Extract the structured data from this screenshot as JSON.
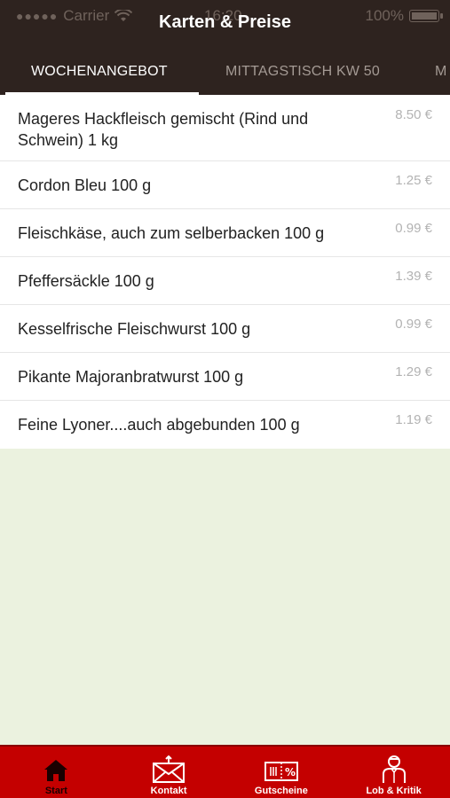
{
  "status": {
    "carrier": "Carrier",
    "time": "16:20",
    "battery": "100%"
  },
  "header": {
    "title": "Karten & Preise"
  },
  "tabs": [
    {
      "label": "WOCHENANGEBOT"
    },
    {
      "label": "MITTAGSTISCH KW 50"
    },
    {
      "label": "M"
    }
  ],
  "items": [
    {
      "name": "Mageres Hackfleisch gemischt (Rind und Schwein) 1 kg",
      "price": "8.50 €"
    },
    {
      "name": "Cordon Bleu 100 g",
      "price": "1.25 €"
    },
    {
      "name": "Fleischkäse, auch zum selberbacken 100 g",
      "price": "0.99 €"
    },
    {
      "name": "Pfeffersäckle 100 g",
      "price": "1.39 €"
    },
    {
      "name": "Kesselfrische Fleischwurst 100 g",
      "price": "0.99 €"
    },
    {
      "name": "Pikante Majoranbratwurst 100 g",
      "price": "1.29 €"
    },
    {
      "name": "Feine Lyoner....auch abgebunden 100 g",
      "price": "1.19 €"
    }
  ],
  "tabbar": [
    {
      "label": "Start",
      "icon": "house-icon"
    },
    {
      "label": "Kontakt",
      "icon": "envelope-icon"
    },
    {
      "label": "Gutscheine",
      "icon": "coupon-icon"
    },
    {
      "label": "Lob & Kritik",
      "icon": "waiter-icon"
    }
  ],
  "colors": {
    "header": "#2e231f",
    "tabbar": "#c40000",
    "background": "#ebf2df"
  }
}
